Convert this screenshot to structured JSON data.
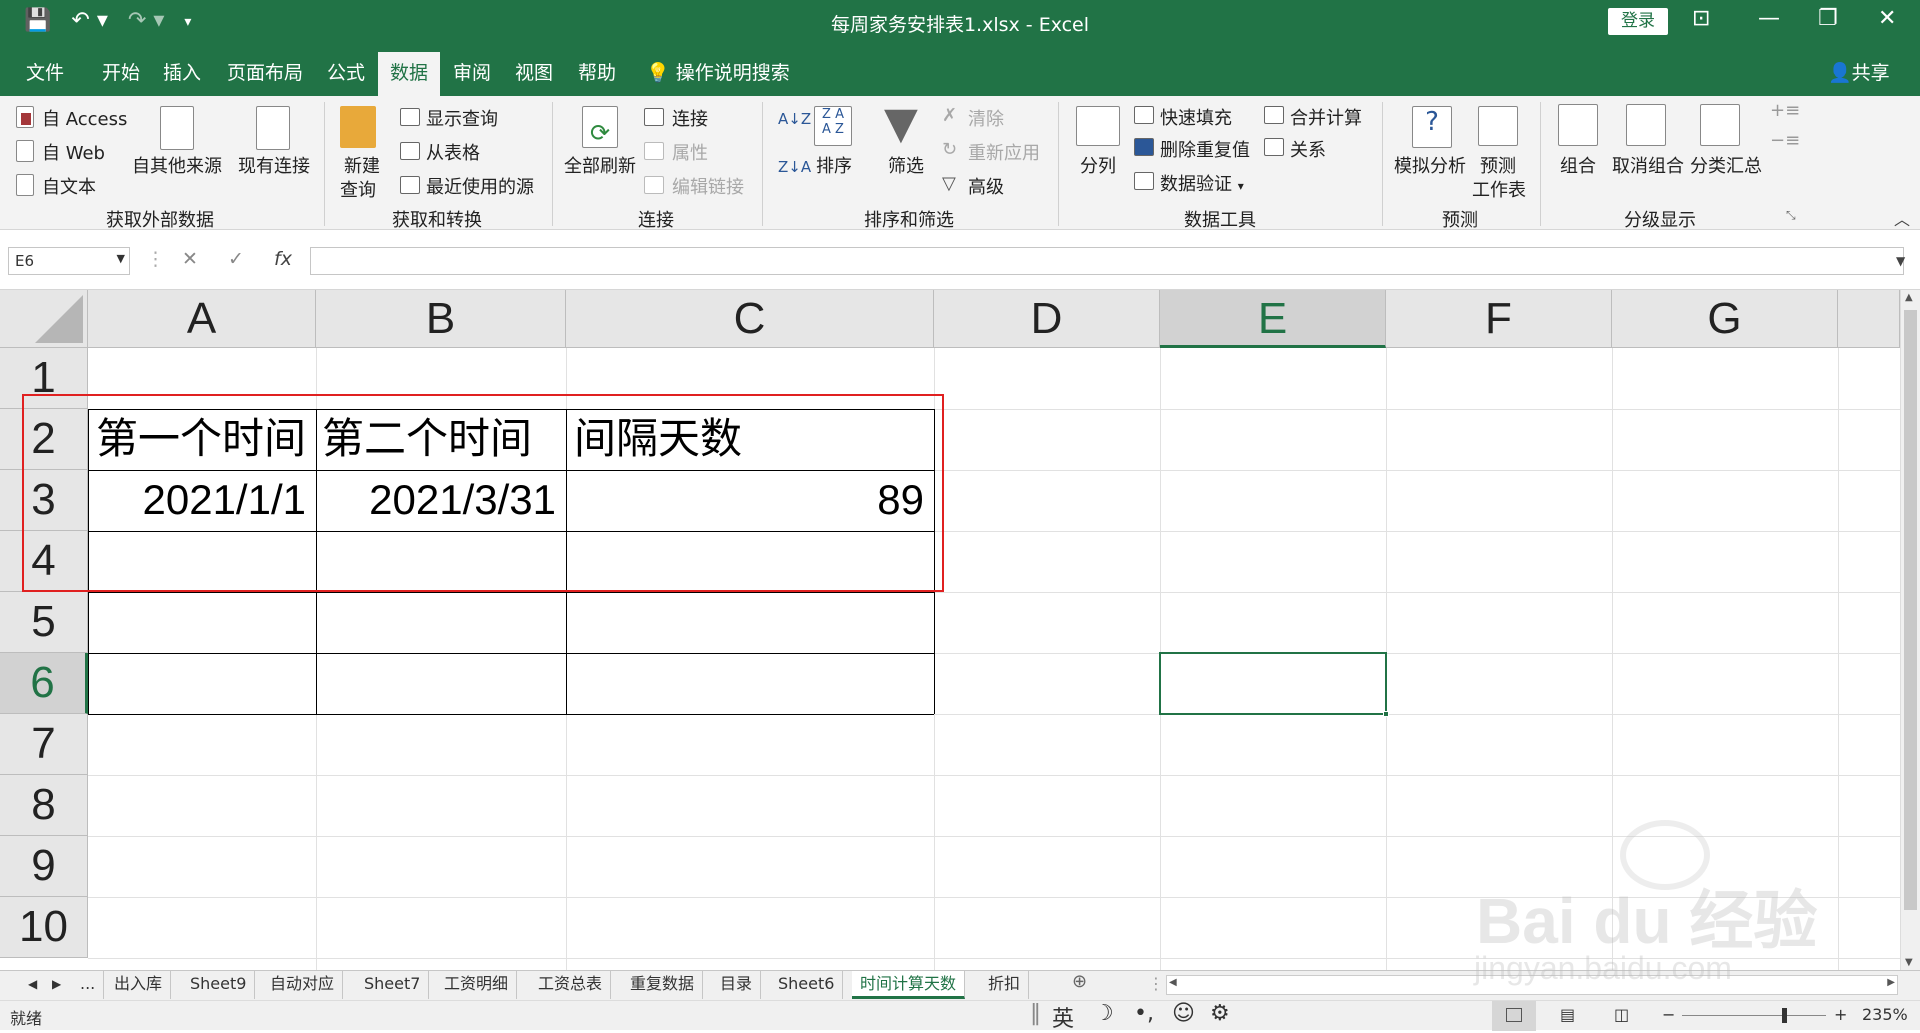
{
  "titlebar": {
    "file_title": "每周家务安排表1.xlsx - Excel",
    "login_label": "登录",
    "save_icon": "save-icon",
    "undo_icon": "undo-icon",
    "redo_icon": "redo-icon"
  },
  "menu": {
    "items": [
      "文件",
      "开始",
      "插入",
      "页面布局",
      "公式",
      "数据",
      "审阅",
      "视图",
      "帮助"
    ],
    "active": "数据",
    "search_label": "操作说明搜索",
    "share_label": "共享"
  },
  "ribbon": {
    "get_external": {
      "access": "自 Access",
      "web": "自 Web",
      "text": "自文本",
      "other": "自其他来源",
      "existing": "现有连接",
      "label": "获取外部数据"
    },
    "get_transform": {
      "new_query_1": "新建",
      "new_query_2": "查询",
      "show_queries": "显示查询",
      "from_table": "从表格",
      "recent_sources": "最近使用的源",
      "label": "获取和转换"
    },
    "connections": {
      "refresh_all": "全部刷新",
      "connections": "连接",
      "properties": "属性",
      "edit_links": "编辑链接",
      "label": "连接"
    },
    "sort_filter": {
      "sort": "排序",
      "filter": "筛选",
      "clear": "清除",
      "reapply": "重新应用",
      "advanced": "高级",
      "label": "排序和筛选"
    },
    "data_tools": {
      "text_to_columns": "分列",
      "flash_fill": "快速填充",
      "remove_duplicates": "删除重复值",
      "data_validation": "数据验证",
      "consolidate": "合并计算",
      "relationships": "关系",
      "label": "数据工具"
    },
    "forecast": {
      "what_if": "模拟分析",
      "forecast_sheet_1": "预测",
      "forecast_sheet_2": "工作表",
      "label": "预测"
    },
    "outline": {
      "group": "组合",
      "ungroup": "取消组合",
      "subtotal": "分类汇总",
      "label": "分级显示"
    }
  },
  "formula_bar": {
    "name_box": "E6",
    "cancel_icon": "✕",
    "enter_icon": "✓",
    "fx_label": "fx",
    "formula": ""
  },
  "sheet": {
    "columns": [
      "A",
      "B",
      "C",
      "D",
      "E",
      "F",
      "G"
    ],
    "selected_column": "E",
    "rows": [
      "1",
      "2",
      "3",
      "4",
      "5",
      "6",
      "7",
      "8",
      "9",
      "10"
    ],
    "selected_row": "6",
    "cells": {
      "A2": "第一个时间",
      "B2": "第二个时间",
      "C2": "间隔天数",
      "A3": "2021/1/1",
      "B3": "2021/3/31",
      "C3": "89"
    },
    "active_cell": "E6"
  },
  "tabs": {
    "nav_ellipsis": "...",
    "items": [
      "出入库",
      "Sheet9",
      "自动对应",
      "Sheet7",
      "工资明细",
      "工资总表",
      "重复数据",
      "目录",
      "Sheet6",
      "时间计算天数",
      "折扣"
    ],
    "active": "时间计算天数",
    "add_icon": "⊕"
  },
  "status": {
    "ready": "就绪",
    "ime": "英",
    "zoom": "235%",
    "zoom_minus": "−",
    "zoom_plus": "+"
  },
  "watermark": {
    "line1": "Bai du 经验",
    "line2": "jingyan.baidu.com"
  },
  "colors": {
    "excel_green": "#217346",
    "highlight_red": "#e02020"
  }
}
